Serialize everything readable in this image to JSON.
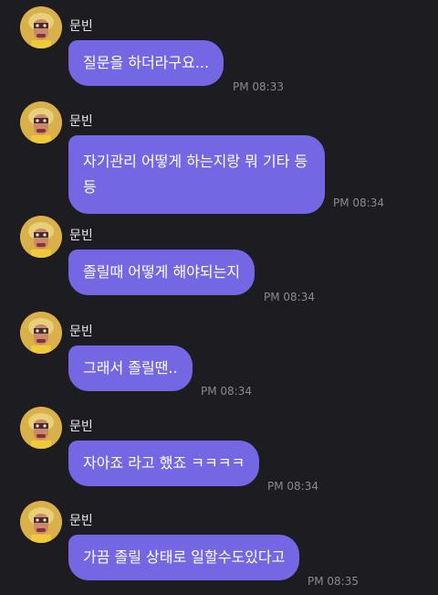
{
  "messages": [
    {
      "sender": "문빈",
      "text": "질문을 하더라구요...",
      "time": "PM 08:33"
    },
    {
      "sender": "문빈",
      "text": "자기관리 어떻게 하는지랑 뭐 기타 등\n등",
      "time": "PM 08:34"
    },
    {
      "sender": "문빈",
      "text": "졸릴때 어떻게 해야되는지",
      "time": "PM 08:34"
    },
    {
      "sender": "문빈",
      "text": "그래서 졸릴땐..",
      "time": "PM 08:34"
    },
    {
      "sender": "문빈",
      "text": "자아죠 라고 했죠 ㅋㅋㅋㅋ",
      "time": "PM 08:34"
    },
    {
      "sender": "문빈",
      "text": "가끔 졸릴 상태로 일할수도있다고",
      "time": "PM 08:35"
    }
  ],
  "colors": {
    "background": "#1c1c21",
    "bubble": "#7467e4",
    "name": "#e6e6ea",
    "timestamp": "#8a8a93"
  },
  "icons": {
    "avatar": "profile-avatar"
  }
}
